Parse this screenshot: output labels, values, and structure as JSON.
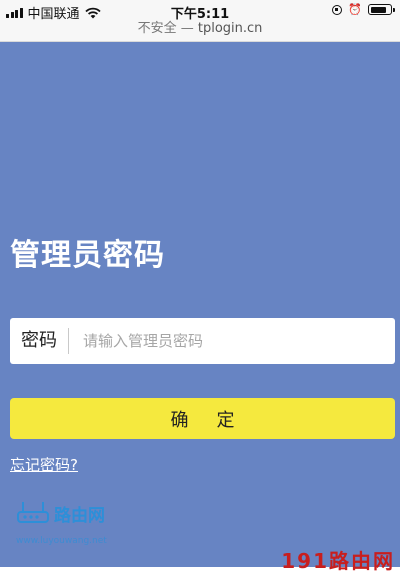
{
  "status_bar": {
    "carrier": "中国联通",
    "time": "下午5:11",
    "icons": [
      "signal-icon",
      "wifi-icon",
      "orientation-lock-icon",
      "alarm-icon",
      "battery-icon"
    ]
  },
  "url_bar": {
    "security": "不安全 —",
    "host": "tplogin.cn"
  },
  "page": {
    "title": "管理员密码",
    "password_label": "密码",
    "password_placeholder": "请输入管理员密码",
    "password_value": "",
    "confirm_label": "确定",
    "forgot_link": "忘记密码?"
  },
  "watermark": {
    "logo_text": "路由网",
    "url": "www.luyouwang.net",
    "brand": "191路由网"
  },
  "colors": {
    "background": "#6784c3",
    "confirm_button": "#f5e93e",
    "watermark_blue": "#2d8fd8",
    "watermark_red": "#c81e1e"
  }
}
